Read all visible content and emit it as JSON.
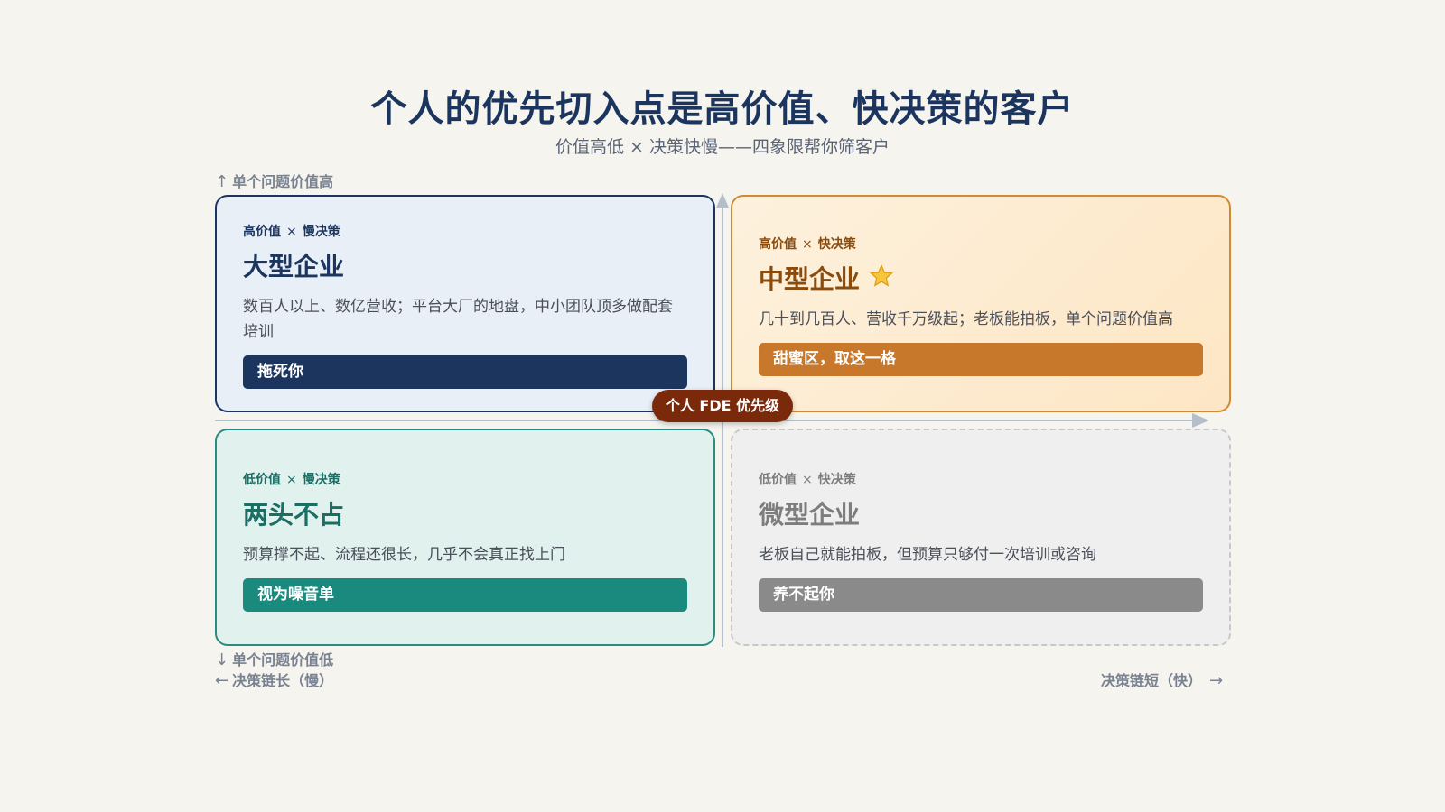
{
  "title": "个人的优先切入点是高价值、快决策的客户",
  "subtitle": "价值高低 × 决策快慢——四象限帮你筛客户",
  "axes": {
    "top": {
      "arrow": "↑",
      "label": "单个问题价值高"
    },
    "bottom": {
      "arrow": "↓",
      "label": "单个问题价值低"
    },
    "left": {
      "arrow": "←",
      "label": "决策链长（慢）"
    },
    "right": {
      "arrow": "→",
      "label": "决策链短（快）"
    }
  },
  "center_badge": "个人 FDE 优先级",
  "quadrants": {
    "top_left": {
      "tag_a": "高价值",
      "tag_x": "×",
      "tag_b": "慢决策",
      "name": "大型企业",
      "desc": "数百人以上、数亿营收；平台大厂的地盘，中小团队顶多做配套培训",
      "verdict": "拖死你",
      "color": "#1c355e"
    },
    "top_right": {
      "tag_a": "高价值",
      "tag_x": "×",
      "tag_b": "快决策",
      "name": "中型企业",
      "icon": "star-icon",
      "desc": "几十到几百人、营收千万级起；老板能拍板，单个问题价值高",
      "verdict": "甜蜜区，取这一格",
      "color": "#c8782a"
    },
    "bottom_left": {
      "tag_a": "低价值",
      "tag_x": "×",
      "tag_b": "慢决策",
      "name": "两头不占",
      "desc": "预算撑不起、流程还很长，几乎不会真正找上门",
      "verdict": "视为噪音单",
      "color": "#1b8a7e"
    },
    "bottom_right": {
      "tag_a": "低价值",
      "tag_x": "×",
      "tag_b": "快决策",
      "name": "微型企业",
      "desc": "老板自己就能拍板，但预算只够付一次培训或咨询",
      "verdict": "养不起你",
      "color": "#8a8a8a"
    }
  }
}
